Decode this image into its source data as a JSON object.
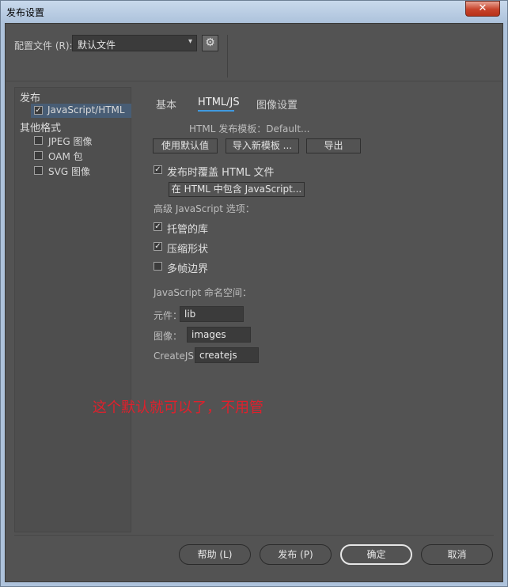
{
  "window": {
    "title": "发布设置",
    "close_glyph": "✕"
  },
  "profile": {
    "label": "配置文件 (R):",
    "value": "默认文件",
    "arrow": "▾",
    "gear_glyph": "⚙"
  },
  "left_panel": {
    "publish_heading": "发布",
    "publish_items": [
      {
        "label": "JavaScript/HTML",
        "checked": true
      }
    ],
    "other_heading": "其他格式",
    "other_items": [
      {
        "label": "JPEG 图像",
        "checked": false
      },
      {
        "label": "OAM 包",
        "checked": false
      },
      {
        "label": "SVG 图像",
        "checked": false
      }
    ]
  },
  "tabs": {
    "basic": "基本",
    "html": "HTML/JS",
    "image": "图像设置"
  },
  "template": {
    "label": "HTML 发布模板：Default...",
    "use_default": "使用默认值",
    "import_new": "导入新模板 ...",
    "export": "导出"
  },
  "overwrite": {
    "label": "发布时覆盖 HTML 文件",
    "checked": true,
    "include_js_button": "在 HTML 中包含 JavaScript..."
  },
  "advanced": {
    "heading": "高级 JavaScript 选项：",
    "hosted_libs": "托管的库",
    "compact_shapes": "压缩形状",
    "multiframe_bounds": "多帧边界"
  },
  "namespace": {
    "heading": "JavaScript 命名空间：",
    "symbols_label": "元件：",
    "symbols_value": "lib",
    "images_label": "图像：",
    "images_value": "images",
    "createjs_label": "CreateJS:",
    "createjs_value": "createjs"
  },
  "annotation": "这个默认就可以了，不用管",
  "footer": {
    "help": "帮助 (L)",
    "publish": "发布 (P)",
    "ok": "确定",
    "cancel": "取消"
  },
  "check_glyph": "✓"
}
